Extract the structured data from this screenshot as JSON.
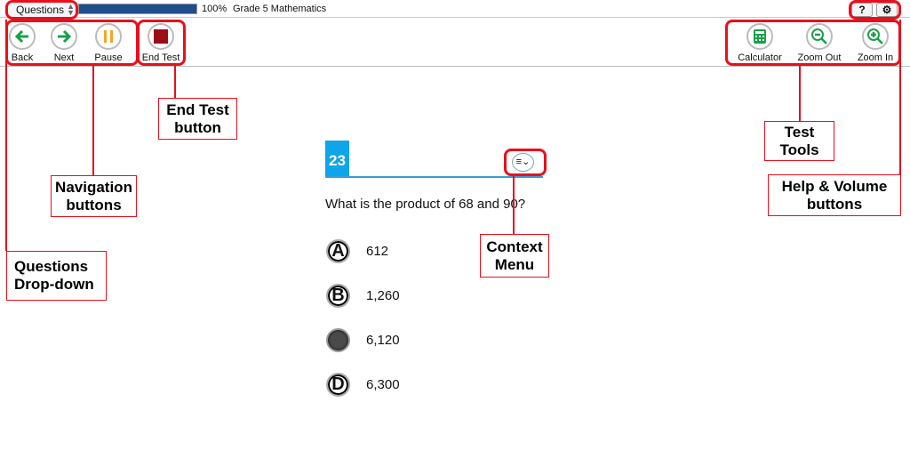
{
  "topbar": {
    "questions_dropdown": "Questions",
    "progress_percent": 100,
    "progress_label": "100%",
    "test_name": "Grade 5 Mathematics",
    "help_label": "?",
    "settings_icon": "gear-icon"
  },
  "toolbar": {
    "back": "Back",
    "next": "Next",
    "pause": "Pause",
    "end_test": "End Test",
    "calculator": "Calculator",
    "zoom_out": "Zoom Out",
    "zoom_in": "Zoom In"
  },
  "question": {
    "number": "23",
    "text": "What is the product of 68 and 90?",
    "selected": "C",
    "options": [
      {
        "letter": "A",
        "text": "612"
      },
      {
        "letter": "B",
        "text": "1,260"
      },
      {
        "letter": "C",
        "text": "6,120"
      },
      {
        "letter": "D",
        "text": "6,300"
      }
    ]
  },
  "annotations": {
    "questions_dropdown": [
      "Questions",
      "Drop-down"
    ],
    "navigation": [
      "Navigation",
      "buttons"
    ],
    "end_test": [
      "End Test",
      "button"
    ],
    "context_menu": [
      "Context",
      "Menu"
    ],
    "test_tools": [
      "Test",
      "Tools"
    ],
    "help_volume": [
      "Help & Volume",
      "buttons"
    ]
  },
  "colors": {
    "annotation": "#e8101c",
    "progress": "#1e4e8c",
    "question_number": "#0ea5e9",
    "nav_arrow": "#1aa04a",
    "pause": "#f5a623",
    "end_test": "#9b0e16",
    "tools": "#1aa04a"
  }
}
